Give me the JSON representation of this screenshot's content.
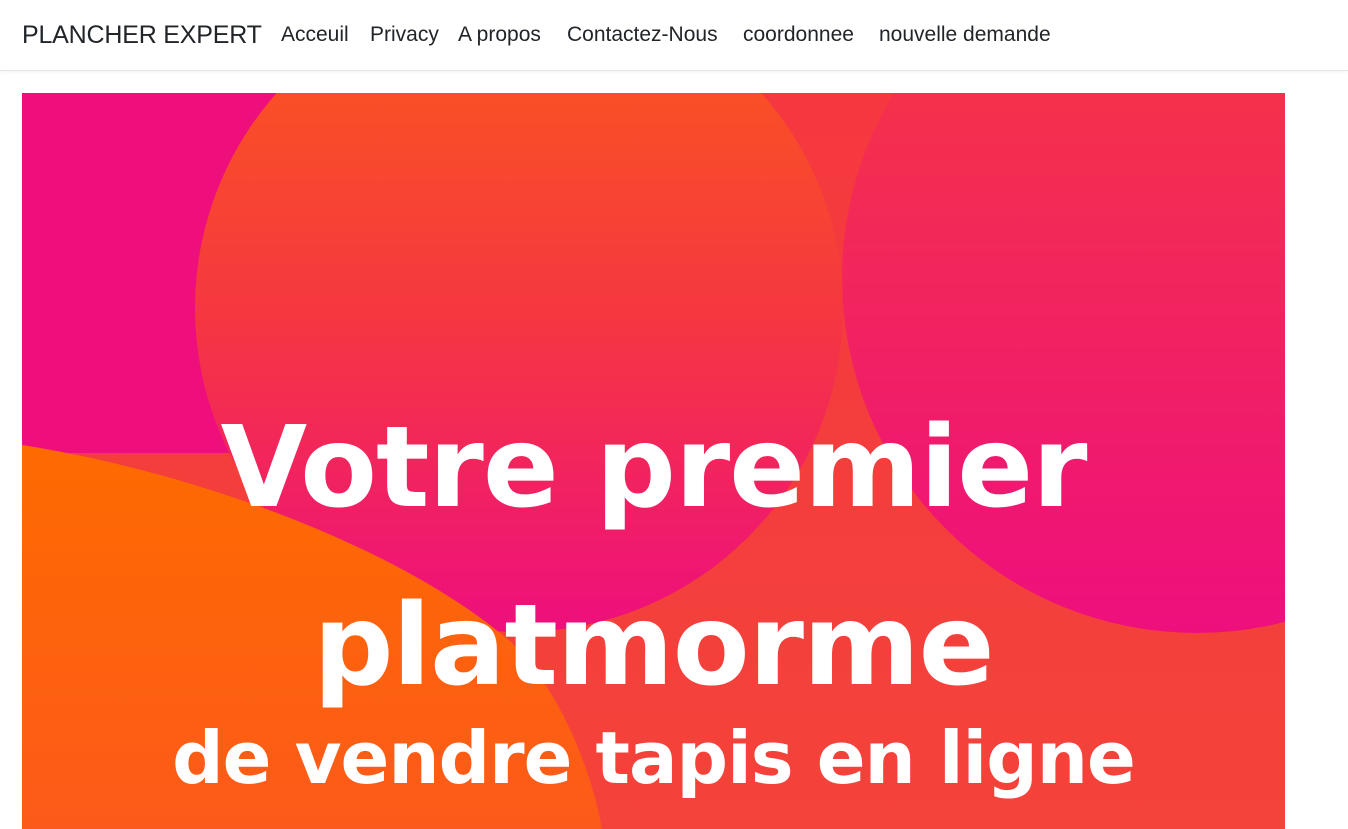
{
  "navbar": {
    "brand": "PLANCHER EXPERT",
    "links": [
      {
        "label": "Acceuil"
      },
      {
        "label": "Privacy"
      },
      {
        "label": "A propos"
      },
      {
        "label": "Contactez-Nous"
      },
      {
        "label": "coordonnee"
      },
      {
        "label": "nouvelle demande"
      }
    ]
  },
  "hero": {
    "line1": "Votre premier",
    "line2": "platmorme",
    "line3": "de vendre tapis en ligne",
    "colors": {
      "magenta": "#ee0f7d",
      "coral": "#f5383f",
      "orange": "#fe6a00",
      "orange_red": "#fc5a1a"
    }
  }
}
